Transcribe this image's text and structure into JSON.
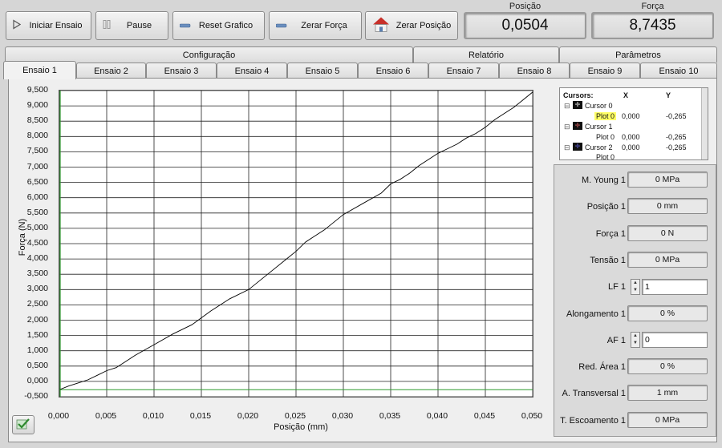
{
  "toolbar": {
    "start_label": "Iniciar Ensaio",
    "pause_label": "Pause",
    "reset_label": "Reset Grafico",
    "zero_force_label": "Zerar Força",
    "zero_position_label": "Zerar Posição"
  },
  "indicators": {
    "position_label": "Posição",
    "position_value": "0,0504",
    "force_label": "Força",
    "force_value": "8,7435"
  },
  "top_tabs": [
    "Configuração",
    "Relatório",
    "Parâmetros"
  ],
  "test_tabs": [
    "Ensaio 1",
    "Ensaio 2",
    "Ensaio 3",
    "Ensaio 4",
    "Ensaio 5",
    "Ensaio 6",
    "Ensaio 7",
    "Ensaio 8",
    "Ensaio 9",
    "Ensaio 10"
  ],
  "cursors": {
    "header": "Cursors:",
    "col_x": "X",
    "col_y": "Y",
    "rows": [
      {
        "name": "Cursor 0",
        "plot": "Plot 0",
        "x": "0,000",
        "y": "-0,265"
      },
      {
        "name": "Cursor 1",
        "plot": "Plot 0",
        "x": "0,000",
        "y": "-0,265"
      },
      {
        "name": "Cursor 2",
        "plot": "Plot 0",
        "x": "0,000",
        "y": "-0,265"
      }
    ]
  },
  "results": {
    "young_label": "M. Young 1",
    "young_value": "0 MPa",
    "position_label": "Posição 1",
    "position_value": "0 mm",
    "force_label": "Força 1",
    "force_value": "0 N",
    "tension_label": "Tensão 1",
    "tension_value": "0 MPa",
    "lf_label": "LF 1",
    "lf_value": "1",
    "elong_label": "Alongamento 1",
    "elong_value": "0 %",
    "af_label": "AF 1",
    "af_value": "0",
    "area_label": "Red. Área 1",
    "area_value": "0 %",
    "transv_label": "A. Transversal 1",
    "transv_value": "1 mm",
    "yield_label": "T. Escoamento 1",
    "yield_value": "0 MPa"
  },
  "chart_data": {
    "type": "line",
    "xlabel": "Posição (mm)",
    "ylabel": "Força (N)",
    "xlim": [
      0,
      0.05
    ],
    "ylim": [
      -0.5,
      9.5
    ],
    "x_ticks": [
      "0,000",
      "0,005",
      "0,010",
      "0,015",
      "0,020",
      "0,025",
      "0,030",
      "0,035",
      "0,040",
      "0,045",
      "0,050"
    ],
    "y_ticks": [
      "9,500",
      "9,000",
      "8,500",
      "8,000",
      "7,500",
      "7,000",
      "6,500",
      "6,000",
      "5,500",
      "5,000",
      "4,500",
      "4,000",
      "3,500",
      "3,000",
      "2,500",
      "2,000",
      "1,500",
      "1,000",
      "0,500",
      "0,000",
      "-0,500"
    ],
    "grid": true,
    "series": [
      {
        "color": "#000000",
        "x": [
          0.0,
          0.001,
          0.002,
          0.003,
          0.004,
          0.005,
          0.006,
          0.007,
          0.008,
          0.01,
          0.012,
          0.014,
          0.016,
          0.018,
          0.02,
          0.022,
          0.024,
          0.025,
          0.026,
          0.027,
          0.028,
          0.03,
          0.032,
          0.034,
          0.035,
          0.036,
          0.037,
          0.038,
          0.04,
          0.041,
          0.042,
          0.043,
          0.044,
          0.045,
          0.046,
          0.047,
          0.048,
          0.049,
          0.05
        ],
        "y": [
          -0.27,
          -0.15,
          -0.05,
          0.05,
          0.2,
          0.35,
          0.45,
          0.65,
          0.85,
          1.2,
          1.55,
          1.85,
          2.3,
          2.7,
          3.0,
          3.5,
          4.0,
          4.25,
          4.55,
          4.75,
          4.95,
          5.45,
          5.8,
          6.15,
          6.45,
          6.6,
          6.8,
          7.05,
          7.45,
          7.6,
          7.75,
          7.95,
          8.1,
          8.3,
          8.55,
          8.75,
          8.95,
          9.2,
          9.45
        ]
      },
      {
        "color": "#2e9a2e",
        "x": [
          0.0,
          0.05
        ],
        "y": [
          -0.27,
          -0.27
        ]
      }
    ]
  }
}
